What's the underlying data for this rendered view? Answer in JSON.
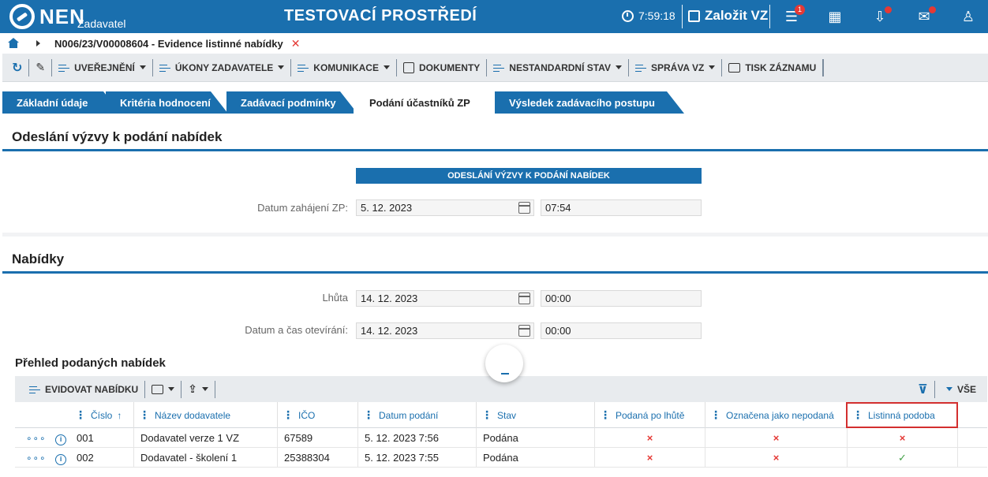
{
  "header": {
    "logo_text": "NEN",
    "logo_sub": "Zadavatel",
    "env_title": "TESTOVACÍ PROSTŘEDÍ",
    "clock": "7:59:18",
    "new_vz": "Založit VZ",
    "notifications_count": "1"
  },
  "breadcrumb": {
    "text": "N006/23/V00008604 - Evidence listinné nabídky"
  },
  "toolbar": {
    "items": [
      "UVEŘEJNĚNÍ",
      "ÚKONY ZADAVATELE",
      "KOMUNIKACE",
      "DOKUMENTY",
      "NESTANDARDNÍ STAV",
      "SPRÁVA VZ",
      "TISK ZÁZNAMU"
    ]
  },
  "tabs": [
    "Základní údaje",
    "Kritéria hodnocení",
    "Zadávací podmínky",
    "Podání účastníků ZP",
    "Výsledek zadávacího postupu"
  ],
  "section1": {
    "title": "Odeslání výzvy k podání nabídek",
    "banner": "ODESLÁNÍ VÝZVY K PODÁNÍ NABÍDEK",
    "start_label": "Datum zahájení ZP:",
    "start_date": "5. 12. 2023",
    "start_time": "07:54"
  },
  "section2": {
    "title": "Nabídky",
    "deadline_label": "Lhůta",
    "deadline_date": "14. 12. 2023",
    "deadline_time": "00:00",
    "open_label": "Datum a čas otevírání:",
    "open_date": "14. 12. 2023",
    "open_time": "00:00"
  },
  "grid": {
    "title": "Přehled podaných nabídek",
    "add_button": "EVIDOVAT NABÍDKU",
    "filter_all": "VŠE",
    "columns": [
      "Číslo",
      "Název dodavatele",
      "IČO",
      "Datum podání",
      "Stav",
      "Podaná po lhůtě",
      "Označena jako nepodaná",
      "Listinná podoba"
    ],
    "rows": [
      {
        "cislo": "001",
        "nazev": "Dodavatel verze 1 VZ",
        "ico": "67589",
        "datum": "5. 12. 2023 7:56",
        "stav": "Podána",
        "po_lhute": "×",
        "nepodana": "×",
        "listinna": "×"
      },
      {
        "cislo": "002",
        "nazev": "Dodavatel - školení 1",
        "ico": "25388304",
        "datum": "5. 12. 2023 7:55",
        "stav": "Podána",
        "po_lhute": "×",
        "nepodana": "×",
        "listinna": "✓"
      }
    ]
  }
}
